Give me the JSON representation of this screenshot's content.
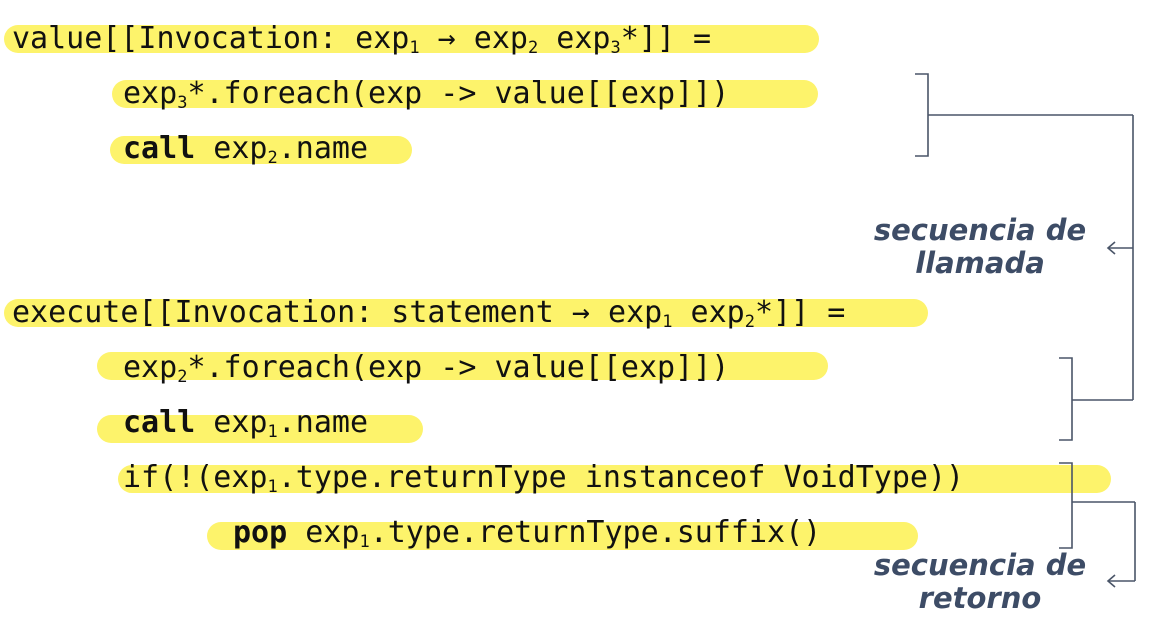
{
  "block1": {
    "header": {
      "a": "value[[Invocation: exp",
      "s1": "1",
      "b": " → exp",
      "s2": "2",
      "c": " exp",
      "s3": "3",
      "d": "*]] ="
    },
    "line1": {
      "a": "exp",
      "s1": "3",
      "b": "*.foreach(exp -> value[[exp]])"
    },
    "line2": {
      "kw": "call",
      "a": " exp",
      "s1": "2",
      "b": ".name"
    }
  },
  "block2": {
    "header": {
      "a": "execute[[Invocation: statement → exp",
      "s1": "1",
      "b": " exp",
      "s2": "2",
      "c": "*]] ="
    },
    "line1": {
      "a": "exp",
      "s1": "2",
      "b": "*.foreach(exp -> value[[exp]])"
    },
    "line2": {
      "kw": "call",
      "a": " exp",
      "s1": "1",
      "b": ".name"
    },
    "line3": {
      "a": "if(!(exp",
      "s1": "1",
      "b": ".type.returnType instanceof VoidType))"
    },
    "line4": {
      "kw": "pop",
      "a": " exp",
      "s1": "1",
      "b": ".type.returnType.suffix()"
    }
  },
  "labels": {
    "call_sequence": [
      "secuencia de",
      "llamada"
    ],
    "return_sequence": [
      "secuencia de",
      "retorno"
    ]
  },
  "colors": {
    "highlight": "#fdf36b",
    "label": "#3d4c66",
    "bracket": "#4a5568"
  }
}
